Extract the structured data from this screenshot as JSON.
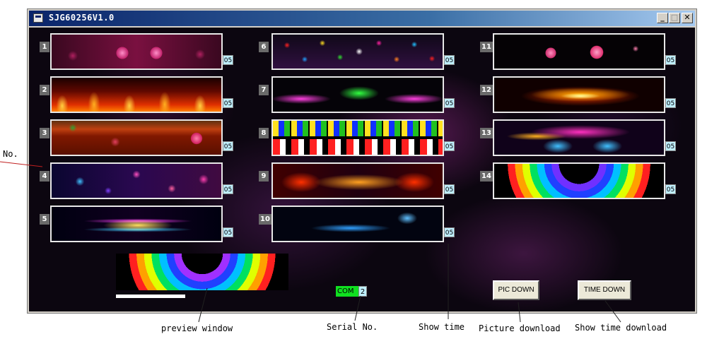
{
  "window": {
    "title": "SJG60256V1.0",
    "minimize_glyph": "_",
    "maximize_glyph": "□",
    "close_glyph": "✕"
  },
  "tiles": [
    {
      "no": "1",
      "time": "05",
      "image": "pink-blossom-strip"
    },
    {
      "no": "2",
      "time": "05",
      "image": "flame-strip"
    },
    {
      "no": "3",
      "time": "05",
      "image": "floral-border-strip"
    },
    {
      "no": "4",
      "time": "05",
      "image": "bokeh-bubbles-strip"
    },
    {
      "no": "5",
      "time": "05",
      "image": "light-waves-strip"
    },
    {
      "no": "6",
      "time": "05",
      "image": "colored-balls-strip"
    },
    {
      "no": "7",
      "time": "05",
      "image": "neon-swirl-strip"
    },
    {
      "no": "8",
      "time": "05",
      "image": "stars-strip"
    },
    {
      "no": "9",
      "time": "05",
      "image": "fire-swirl-strip"
    },
    {
      "no": "10",
      "time": "05",
      "image": "blue-dragon-strip"
    },
    {
      "no": "11",
      "time": "05",
      "image": "pink-flowers-strip"
    },
    {
      "no": "12",
      "time": "05",
      "image": "golden-wings-strip"
    },
    {
      "no": "13",
      "time": "05",
      "image": "smoke-swirl-strip"
    },
    {
      "no": "14",
      "time": "05",
      "image": "rainbow-arcs-strip"
    }
  ],
  "preview": {
    "image": "rainbow-arcs-preview"
  },
  "serial": {
    "label": "COM",
    "port": "2"
  },
  "buttons": {
    "pic_down": "PIC DOWN",
    "time_down": "TIME DOWN"
  },
  "annotations": {
    "no": "No.",
    "preview_window": "preview window",
    "serial_no": "Serial No.",
    "show_time": "Show time",
    "picture_download": "Picture download",
    "show_time_download": "Show time download"
  }
}
